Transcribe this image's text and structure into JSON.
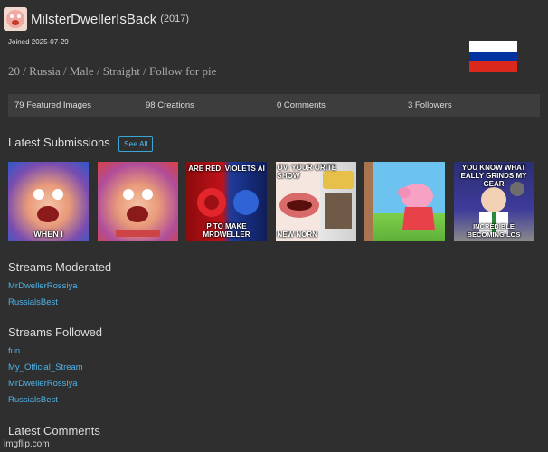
{
  "profile": {
    "username": "MilsterDwellerIsBack",
    "year": "(2017)",
    "joined": "Joined 2025-07-29",
    "bio": "20 / Russia / Male / Straight / Follow for pie",
    "flag_colors": [
      "#ffffff",
      "#0033a0",
      "#da291c"
    ]
  },
  "stats": [
    "79 Featured Images",
    "98 Creations",
    "0 Comments",
    "3 Followers"
  ],
  "latest_submissions": {
    "title": "Latest Submissions",
    "see_all": "See All",
    "thumbnails": [
      {
        "top": "",
        "bottom": "WHEN I"
      },
      {
        "top": "",
        "bottom": ""
      },
      {
        "top": "ARE RED, VIOLETS AI",
        "bottom": "P TO MAKE MRDWELLER"
      },
      {
        "top": "OV: YOUR ORITE SHOW",
        "bottom": "NEW NORN"
      },
      {
        "top": "",
        "bottom": ""
      },
      {
        "top": "YOU KNOW WHAT EALLY GRINDS MY GEAR",
        "bottom": "INCREDIBLE BECOMING LOS"
      }
    ]
  },
  "streams_moderated": {
    "title": "Streams Moderated",
    "items": [
      "MrDwellerRossiya",
      "RussialsBest"
    ]
  },
  "streams_followed": {
    "title": "Streams Followed",
    "items": [
      "fun",
      "My_Official_Stream",
      "MrDwellerRossiya",
      "RussialsBest"
    ]
  },
  "latest_comments": {
    "title": "Latest Comments"
  },
  "watermark": "imgflip.com",
  "colors": {
    "link": "#4fb3e8",
    "background": "#2f2f2f",
    "stats_bar": "#3d3d3d"
  }
}
